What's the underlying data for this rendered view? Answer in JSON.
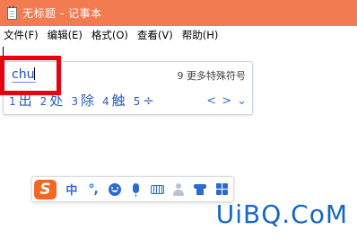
{
  "window": {
    "title": "无标题 - 记事本",
    "title_bar_color": "#f37b52"
  },
  "menubar": {
    "items": [
      "文件(F)",
      "编辑(E)",
      "格式(O)",
      "查看(V)",
      "帮助(H)"
    ]
  },
  "ime": {
    "input_text": "chu",
    "more_symbols": "9 更多特殊符号",
    "candidates": [
      {
        "num": "1",
        "text": "出"
      },
      {
        "num": "2",
        "text": "处"
      },
      {
        "num": "3",
        "text": "除"
      },
      {
        "num": "4",
        "text": "触"
      },
      {
        "num": "5",
        "text": "÷"
      }
    ],
    "nav": {
      "prev": "<",
      "next": ">",
      "expand": "⌄"
    },
    "highlight_color": "#e60012"
  },
  "sogou_bar": {
    "logo": "S",
    "mode_label": "中",
    "punct_label": "°,",
    "icons": [
      "sogou-logo-icon",
      "emoji-icon",
      "microphone-icon",
      "keyboard-icon",
      "user-icon",
      "skin-shirt-icon",
      "toolbox-grid-icon"
    ]
  },
  "watermark": {
    "text": "UiBQ.CoM",
    "color": "#1467c8"
  }
}
